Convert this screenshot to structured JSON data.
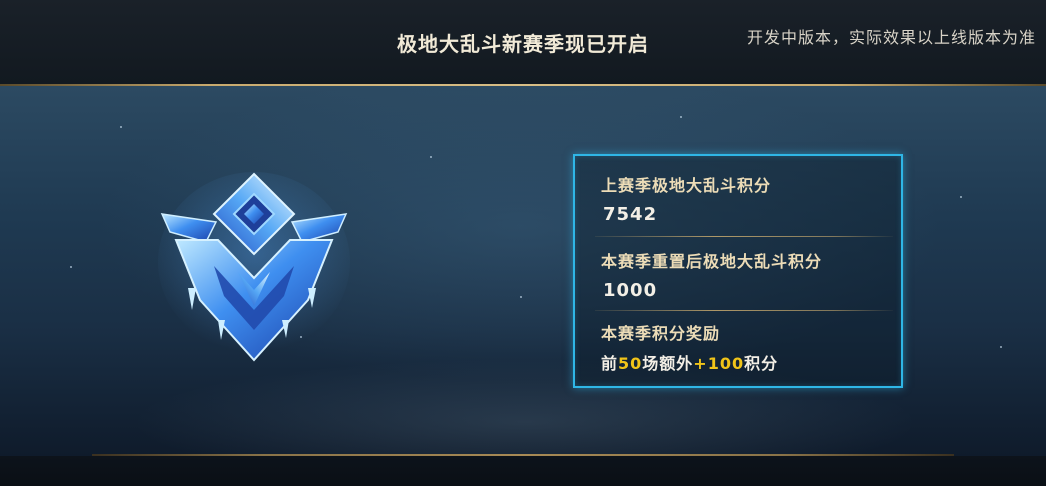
{
  "header": {
    "title": "极地大乱斗新赛季现已开启",
    "notice": "开发中版本，实际效果以上线版本为准"
  },
  "panel": {
    "last_season_label": "上赛季极地大乱斗积分",
    "last_season_value": "7542",
    "reset_label": "本赛季重置后极地大乱斗积分",
    "reset_value": "1000",
    "reward_label": "本赛季积分奖励",
    "reward": {
      "prefix": "前",
      "games": "50",
      "middle": "场额外",
      "bonus": "+100",
      "suffix": "积分"
    }
  },
  "emblem": {
    "icon": "ice-rank-emblem-icon"
  },
  "colors": {
    "gold": "#c8aa6e",
    "frame": "#2fb6e6",
    "highlight": "#f0c419"
  }
}
